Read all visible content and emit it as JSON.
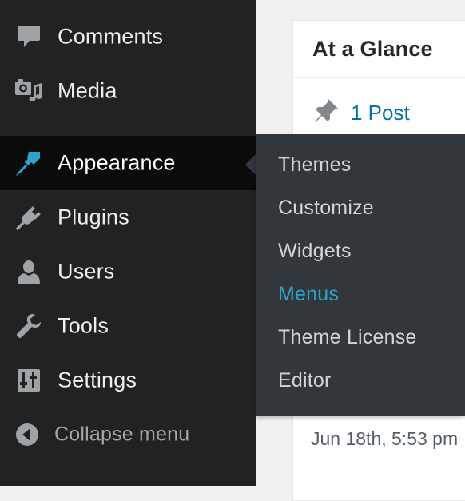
{
  "sidebar": {
    "items": [
      {
        "id": "comments",
        "label": "Comments",
        "icon": "comment-icon"
      },
      {
        "id": "media",
        "label": "Media",
        "icon": "media-icon"
      },
      {
        "id": "appearance",
        "label": "Appearance",
        "icon": "paint-brush-icon",
        "current": true
      },
      {
        "id": "plugins",
        "label": "Plugins",
        "icon": "plugin-icon"
      },
      {
        "id": "users",
        "label": "Users",
        "icon": "user-icon"
      },
      {
        "id": "tools",
        "label": "Tools",
        "icon": "wrench-icon"
      },
      {
        "id": "settings",
        "label": "Settings",
        "icon": "settings-sliders-icon"
      }
    ],
    "collapse_label": "Collapse menu",
    "collapse_icon": "collapse-arrow-icon"
  },
  "submenu": {
    "items": [
      {
        "label": "Themes"
      },
      {
        "label": "Customize"
      },
      {
        "label": "Widgets"
      },
      {
        "label": "Menus",
        "active": true
      },
      {
        "label": "Theme License"
      },
      {
        "label": "Editor"
      }
    ]
  },
  "glance": {
    "title": "At a Glance",
    "post_count": "1 Post",
    "post_icon": "pushpin-icon",
    "date_text": "Jun 18th, 5:53 pm"
  },
  "colors": {
    "sidebar_bg": "#222222",
    "submenu_bg": "#32373c",
    "accent": "#2ea2cc",
    "link": "#0073aa"
  }
}
